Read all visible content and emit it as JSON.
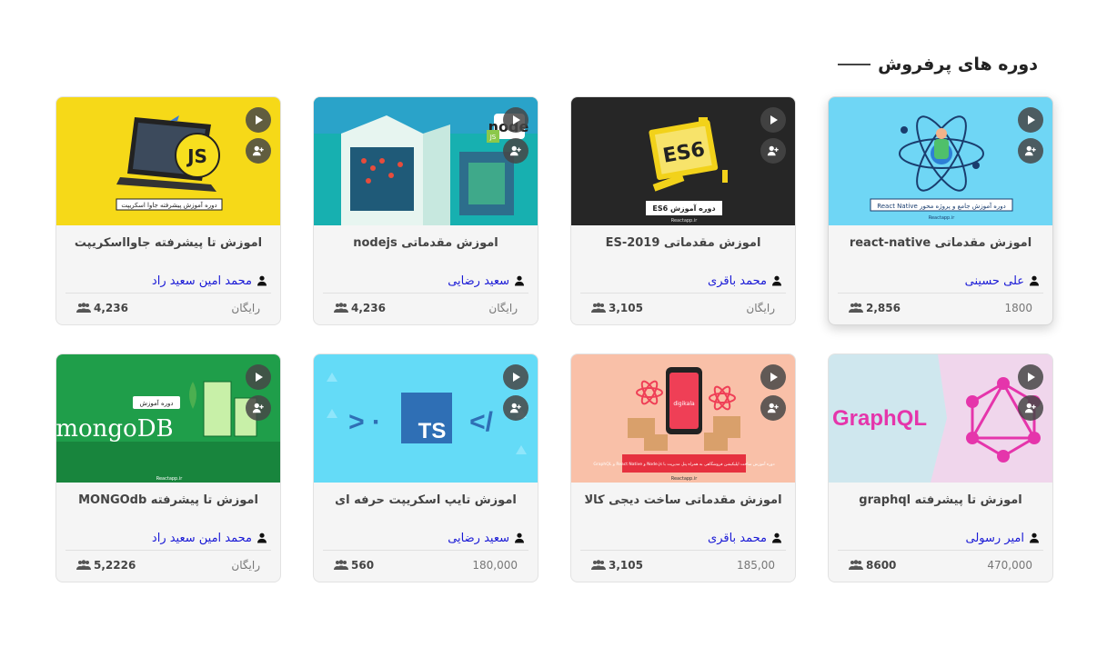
{
  "section": {
    "title": "دوره های پرفروش"
  },
  "courses": [
    {
      "title": "اموزش مقدماتی react-native",
      "instructor": "علی حسینی",
      "students": "2,856",
      "price": "1800",
      "thumb": {
        "bg": "#6fd6f5",
        "banner": "دوره آموزش جامع و پروژه محور React Native",
        "footer": "Reactapp.ir"
      }
    },
    {
      "title": "اموزش مقدماتی ES-2019",
      "instructor": "محمد باقری",
      "students": "3,105",
      "price": "رایگان",
      "thumb": {
        "bg": "#262626",
        "banner": "دوره آموزش ES6",
        "badge": "ES6",
        "footer": "Reactapp.ir"
      }
    },
    {
      "title": "اموزش مقدماتی nodejs",
      "instructor": "سعید رضایی",
      "students": "4,236",
      "price": "رایگان",
      "thumb": {
        "bg": "#17b0b0",
        "logo": "node",
        "badge": "JS"
      }
    },
    {
      "title": "اموزش تا پیشرفته جاوااسکریپت",
      "instructor": "محمد امین سعید راد",
      "students": "4,236",
      "price": "رایگان",
      "thumb": {
        "bg": "#f6d918",
        "banner": "دوره آموزش پیشرفته جاوا اسکریپت",
        "badge": "JS"
      }
    },
    {
      "title": "اموزش تا پیشرفته graphql",
      "instructor": "امیر رسولی",
      "students": "8600",
      "price": "470,000",
      "thumb": {
        "bg": "#cfe7ee",
        "logo": "GraphQL"
      }
    },
    {
      "title": "اموزش مقدماتی ساخت دیجی کالا",
      "instructor": "محمد باقری",
      "students": "3,105",
      "price": "185,00",
      "thumb": {
        "bg": "#f9c0a8",
        "banner": "دوره آموزش ساخت اپلیکیشن فروشگاهی به همراه پنل مدیریت با Node.js و React Native و GraphQL",
        "brand": "digikala",
        "footer": "Reactapp.ir"
      }
    },
    {
      "title": "اموزش تایپ اسکریپت حرفه ای",
      "instructor": "سعید رضایی",
      "students": "560",
      "price": "180,000",
      "thumb": {
        "bg": "#64dbf7",
        "badge": "TS",
        "left": "· <",
        "right": "/>"
      }
    },
    {
      "title": "اموزش تا پیشرفته MONGOdb",
      "instructor": "محمد امین سعید راد",
      "students": "5,2226",
      "price": "رایگان",
      "thumb": {
        "bg": "#1f9e4a",
        "logo": "mongoDB",
        "banner": "دوره آموزش",
        "footer": "Reactapp.ir"
      }
    }
  ],
  "icons": {
    "play": "play-icon",
    "enroll": "add-user-icon",
    "person": "person-icon",
    "students": "users-icon"
  },
  "colors": {
    "instructor": "#1a1ad6",
    "fab": "#4a4a4a"
  }
}
